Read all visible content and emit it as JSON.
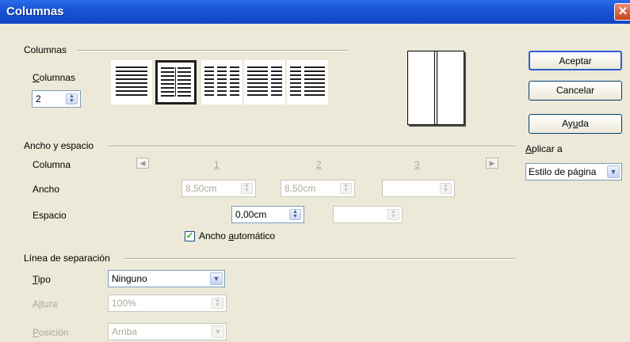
{
  "window": {
    "title": "Columnas",
    "close_symbol": "✕"
  },
  "columns_group": {
    "label": "Columnas",
    "count_label": "Columnas",
    "count_value": "2",
    "layouts": [
      "one-column",
      "two-columns",
      "three-columns",
      "wide-left-narrow-right",
      "narrow-left-wide-right"
    ],
    "selected_layout": "two-columns"
  },
  "buttons": {
    "ok": "Aceptar",
    "cancel": "Cancelar",
    "help": "Ayuda"
  },
  "apply_to": {
    "label": "Aplicar a",
    "value": "Estilo de página"
  },
  "width_spacing": {
    "label": "Ancho y espacio",
    "column_label": "Columna",
    "column_numbers": [
      "1",
      "2",
      "3"
    ],
    "width_label": "Ancho",
    "width_values": [
      "8,50cm",
      "8,50cm",
      ""
    ],
    "spacing_label": "Espacio",
    "spacing_values": [
      "0,00cm",
      ""
    ],
    "auto_width_label": "Ancho automático",
    "auto_width_checked": true
  },
  "separator": {
    "label": "Línea de separación",
    "type_label": "Tipo",
    "type_value": "Ninguno",
    "height_label": "Altura",
    "height_value": "100%",
    "position_label": "Posición",
    "position_value": "Arriba"
  }
}
